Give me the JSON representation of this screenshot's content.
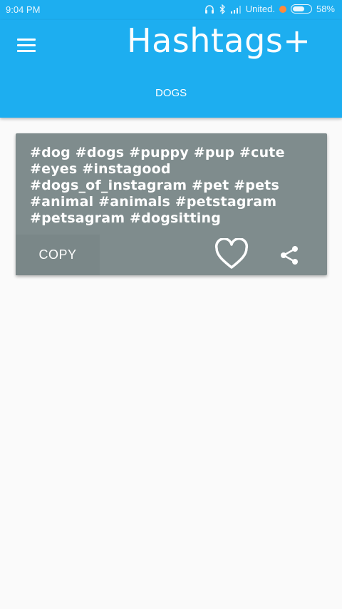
{
  "status_bar": {
    "time": "9:04 PM",
    "carrier": "United.",
    "battery": "58%",
    "icons": [
      "headphones-icon",
      "bluetooth-icon",
      "signal-icon",
      "battery-icon"
    ]
  },
  "app_bar": {
    "title": "Hashtags+",
    "menu_icon": "hamburger-menu-icon",
    "tab_label": "DOGS"
  },
  "card": {
    "hashtags": "#dog #dogs #puppy #pup #cute #eyes #instagood #dogs_of_instagram #pet #pets #animal #animals #petstagram #petsagram #dogsitting",
    "copy_label": "COPY",
    "like_icon": "heart-outline-icon",
    "share_icon": "share-icon"
  },
  "colors": {
    "primary": "#1daef0",
    "card_background": "#7f8c8d",
    "page_background": "#fafafa"
  }
}
